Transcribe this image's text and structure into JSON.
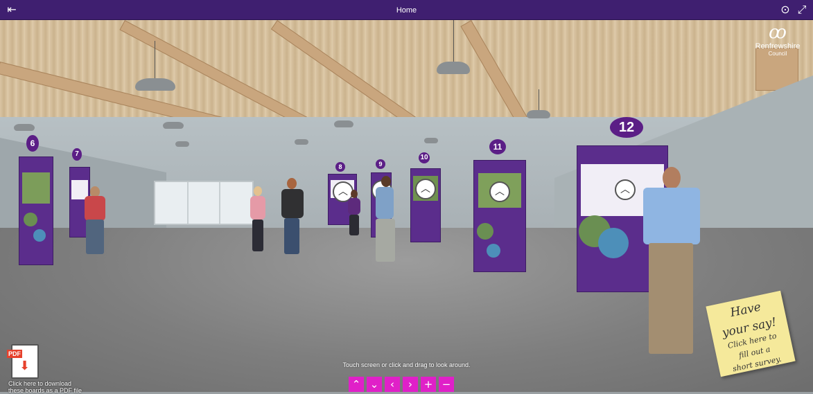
{
  "window": {
    "title": "Home",
    "menu_icon": "menu-collapse-icon",
    "play_icon": "play-circle-icon",
    "fullscreen_icon": "fullscreen-icon"
  },
  "brand": {
    "name_line1": "Renfrewshire",
    "name_line2": "Council",
    "logo_icon": "council-logo-icon"
  },
  "boards": [
    {
      "number": "6"
    },
    {
      "number": "7"
    },
    {
      "number": "8"
    },
    {
      "number": "9"
    },
    {
      "number": "10"
    },
    {
      "number": "11"
    },
    {
      "number": "12"
    }
  ],
  "survey_note": {
    "line1": "Have",
    "line2": "your say!",
    "line3": "Click here to",
    "line4": "fill out a",
    "line5": "short survey."
  },
  "pdf_download": {
    "badge": "PDF",
    "caption_line1": "Click here to download",
    "caption_line2": "these boards as a PDF file"
  },
  "hint": "Touch screen or click and drag to look around.",
  "nav_controls": [
    {
      "label": "^",
      "icon": "chevron-up-icon"
    },
    {
      "label": "v",
      "icon": "chevron-down-icon"
    },
    {
      "label": "<",
      "icon": "chevron-left-icon"
    },
    {
      "label": ">",
      "icon": "chevron-right-icon"
    },
    {
      "label": "+",
      "icon": "zoom-in-icon"
    },
    {
      "label": "−",
      "icon": "zoom-out-icon"
    }
  ],
  "colors": {
    "topbar": "#3f1f70",
    "board_purple": "#5b2d8c",
    "nav_magenta": "#e020c8",
    "sticky_note": "#f5e99b",
    "pdf_red": "#e6412c"
  }
}
